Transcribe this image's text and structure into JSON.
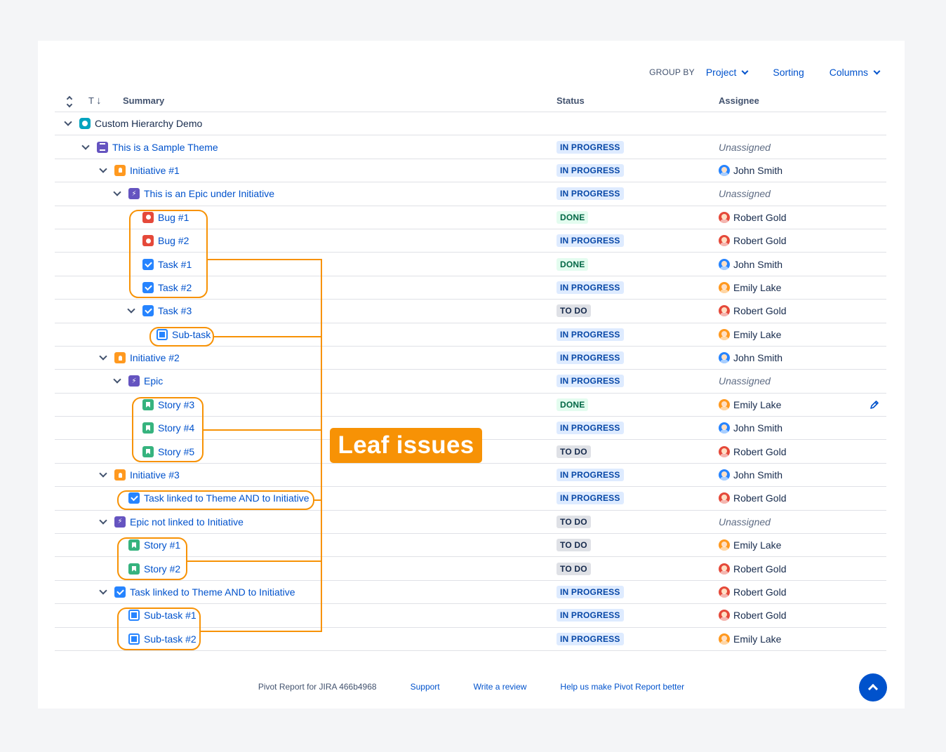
{
  "toolbar": {
    "group_by_label": "GROUP BY",
    "group_by_value": "Project",
    "sorting_label": "Sorting",
    "columns_label": "Columns"
  },
  "table": {
    "headers": {
      "type": "T",
      "summary": "Summary",
      "status": "Status",
      "assignee": "Assignee"
    },
    "rows": [
      {
        "level": 0,
        "expand": true,
        "type": "project",
        "summary": "Custom Hierarchy Demo",
        "status": "",
        "status_kind": "",
        "assignee": "",
        "avatar": ""
      },
      {
        "level": 1,
        "expand": true,
        "type": "theme",
        "summary": "This is a Sample Theme",
        "status": "IN PROGRESS",
        "status_kind": "inprogress",
        "assignee": "Unassigned",
        "avatar": ""
      },
      {
        "level": 2,
        "expand": true,
        "type": "initiative",
        "summary": "Initiative #1",
        "status": "IN PROGRESS",
        "status_kind": "inprogress",
        "assignee": "John Smith",
        "avatar": "john"
      },
      {
        "level": 3,
        "expand": true,
        "type": "epic",
        "summary": "This is an Epic under Initiative",
        "status": "IN PROGRESS",
        "status_kind": "inprogress",
        "assignee": "Unassigned",
        "avatar": ""
      },
      {
        "level": 4,
        "expand": false,
        "type": "bug",
        "summary": "Bug #1",
        "status": "DONE",
        "status_kind": "done",
        "assignee": "Robert Gold",
        "avatar": "robert"
      },
      {
        "level": 4,
        "expand": false,
        "type": "bug",
        "summary": "Bug #2",
        "status": "IN PROGRESS",
        "status_kind": "inprogress",
        "assignee": "Robert Gold",
        "avatar": "robert"
      },
      {
        "level": 4,
        "expand": false,
        "type": "task",
        "summary": "Task #1",
        "status": "DONE",
        "status_kind": "done",
        "assignee": "John Smith",
        "avatar": "john"
      },
      {
        "level": 4,
        "expand": false,
        "type": "task",
        "summary": "Task #2",
        "status": "IN PROGRESS",
        "status_kind": "inprogress",
        "assignee": "Emily Lake",
        "avatar": "emily"
      },
      {
        "level": 4,
        "expand": true,
        "type": "task",
        "summary": "Task #3",
        "status": "TO DO",
        "status_kind": "todo",
        "assignee": "Robert Gold",
        "avatar": "robert"
      },
      {
        "level": 5,
        "expand": false,
        "type": "subtask",
        "summary": "Sub-task",
        "status": "IN PROGRESS",
        "status_kind": "inprogress",
        "assignee": "Emily Lake",
        "avatar": "emily"
      },
      {
        "level": 2,
        "expand": true,
        "type": "initiative",
        "summary": "Initiative #2",
        "status": "IN PROGRESS",
        "status_kind": "inprogress",
        "assignee": "John Smith",
        "avatar": "john"
      },
      {
        "level": 3,
        "expand": true,
        "type": "epic",
        "summary": "Epic",
        "status": "IN PROGRESS",
        "status_kind": "inprogress",
        "assignee": "Unassigned",
        "avatar": ""
      },
      {
        "level": 4,
        "expand": false,
        "type": "story",
        "summary": "Story #3",
        "status": "DONE",
        "status_kind": "done",
        "assignee": "Emily Lake",
        "avatar": "emily",
        "edit": true
      },
      {
        "level": 4,
        "expand": false,
        "type": "story",
        "summary": "Story #4",
        "status": "IN PROGRESS",
        "status_kind": "inprogress",
        "assignee": "John Smith",
        "avatar": "john"
      },
      {
        "level": 4,
        "expand": false,
        "type": "story",
        "summary": "Story #5",
        "status": "TO DO",
        "status_kind": "todo",
        "assignee": "Robert Gold",
        "avatar": "robert"
      },
      {
        "level": 2,
        "expand": true,
        "type": "initiative",
        "summary": "Initiative #3",
        "status": "IN PROGRESS",
        "status_kind": "inprogress",
        "assignee": "John Smith",
        "avatar": "john"
      },
      {
        "level": 3,
        "expand": false,
        "type": "task",
        "summary": "Task linked to Theme AND to Initiative",
        "status": "IN PROGRESS",
        "status_kind": "inprogress",
        "assignee": "Robert Gold",
        "avatar": "robert"
      },
      {
        "level": 2,
        "expand": true,
        "type": "epic",
        "summary": "Epic not linked to Initiative",
        "status": "TO DO",
        "status_kind": "todo",
        "assignee": "Unassigned",
        "avatar": ""
      },
      {
        "level": 3,
        "expand": false,
        "type": "story",
        "summary": "Story #1",
        "status": "TO DO",
        "status_kind": "todo",
        "assignee": "Emily Lake",
        "avatar": "emily"
      },
      {
        "level": 3,
        "expand": false,
        "type": "story",
        "summary": "Story #2",
        "status": "TO DO",
        "status_kind": "todo",
        "assignee": "Robert Gold",
        "avatar": "robert"
      },
      {
        "level": 2,
        "expand": true,
        "type": "task",
        "summary": "Task linked to Theme AND to Initiative",
        "status": "IN PROGRESS",
        "status_kind": "inprogress",
        "assignee": "Robert Gold",
        "avatar": "robert"
      },
      {
        "level": 3,
        "expand": false,
        "type": "subtask",
        "summary": "Sub-task #1",
        "status": "IN PROGRESS",
        "status_kind": "inprogress",
        "assignee": "Robert Gold",
        "avatar": "robert"
      },
      {
        "level": 3,
        "expand": false,
        "type": "subtask",
        "summary": "Sub-task #2",
        "status": "IN PROGRESS",
        "status_kind": "inprogress",
        "assignee": "Emily Lake",
        "avatar": "emily"
      }
    ]
  },
  "footer": {
    "product": "Pivot Report for JIRA 466b4968",
    "support": "Support",
    "review": "Write a review",
    "feedback": "Help us make Pivot Report better"
  },
  "annotation": {
    "label": "Leaf issues",
    "color": "#f79205"
  },
  "icons": {
    "sort": "sort-arrows-icon",
    "dropdown": "chevron-down-icon",
    "edit": "pencil-icon",
    "scroll_top": "chevron-up-icon"
  }
}
